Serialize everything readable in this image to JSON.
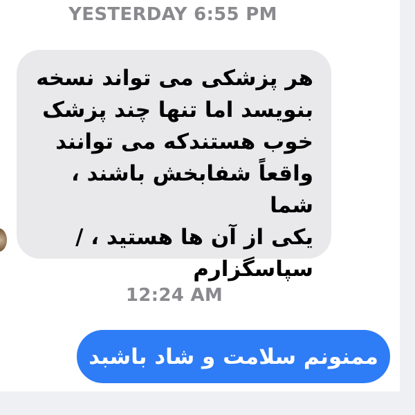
{
  "conversation": {
    "timestamps": [
      "YESTERDAY 6:55 PM",
      "12:24 AM"
    ],
    "incoming_message": "هر پزشکی می تواند نسخه\nبنویسد اما تنها چند پزشک\nخوب هستندکه می توانند\nواقعاً شفابخش باشند ، شما\nیکی از آن ها هستید ، /\nسپاسگزارم",
    "outgoing_message": "ممنونم سلامت و شاد باشبد"
  },
  "colors": {
    "incoming_bubble": "#e9e9eb",
    "outgoing_bubble": "#2e7cf6",
    "timestamp_text": "#8a8a8e"
  }
}
